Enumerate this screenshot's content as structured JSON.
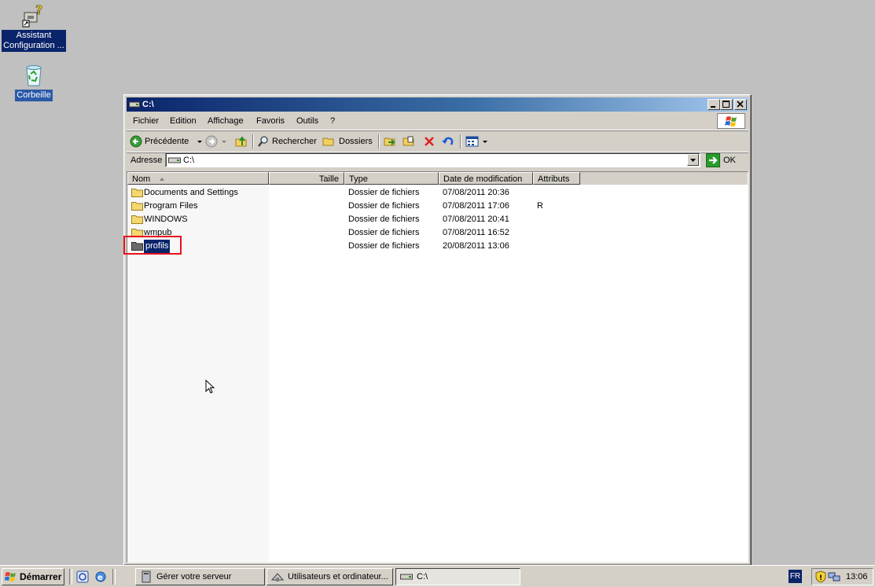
{
  "desktop": {
    "icons": [
      {
        "label_line1": "Assistant",
        "label_line2": "Configuration ..."
      },
      {
        "label_line1": "Corbeille"
      }
    ]
  },
  "window": {
    "title": "C:\\",
    "menu": [
      "Fichier",
      "Edition",
      "Affichage",
      "Favoris",
      "Outils",
      "?"
    ],
    "toolbar": {
      "back_label": "Précédente",
      "search_label": "Rechercher",
      "folders_label": "Dossiers"
    },
    "address": {
      "label": "Adresse",
      "value": "C:\\",
      "go_label": "OK"
    },
    "columns": [
      "Nom",
      "Taille",
      "Type",
      "Date de modification",
      "Attributs"
    ],
    "files": [
      {
        "name": "Documents and Settings",
        "size": "",
        "type": "Dossier de fichiers",
        "modified": "07/08/2011 20:36",
        "attrs": ""
      },
      {
        "name": "Program Files",
        "size": "",
        "type": "Dossier de fichiers",
        "modified": "07/08/2011 17:06",
        "attrs": "R"
      },
      {
        "name": "WINDOWS",
        "size": "",
        "type": "Dossier de fichiers",
        "modified": "07/08/2011 20:41",
        "attrs": ""
      },
      {
        "name": "wmpub",
        "size": "",
        "type": "Dossier de fichiers",
        "modified": "07/08/2011 16:52",
        "attrs": ""
      },
      {
        "name": "profils",
        "size": "",
        "type": "Dossier de fichiers",
        "modified": "20/08/2011 13:06",
        "attrs": "",
        "selected": true
      }
    ]
  },
  "taskbar": {
    "start_label": "Démarrer",
    "tasks": [
      {
        "label": "Gérer votre serveur"
      },
      {
        "label": "Utilisateurs et ordinateur..."
      },
      {
        "label": "C:\\",
        "active": true
      }
    ],
    "lang": "FR",
    "clock": "13:06"
  },
  "colors": {
    "desktop": "#c0c0c0",
    "titlebar_start": "#0a246a",
    "selection": "#0a246a",
    "highlight_box": "#e8121c"
  }
}
